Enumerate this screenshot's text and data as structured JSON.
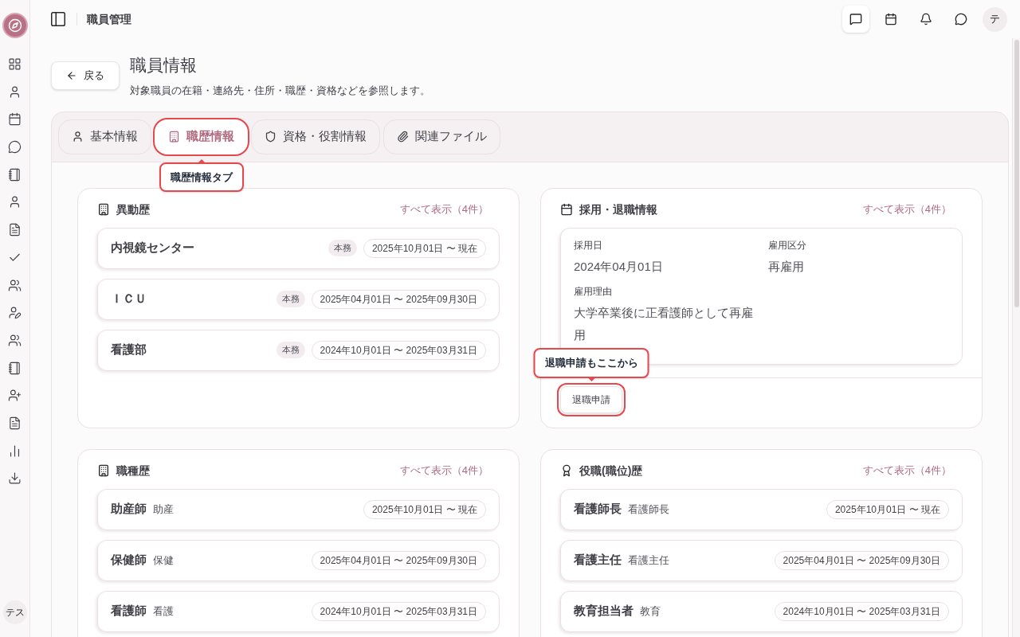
{
  "header": {
    "title": "職員管理",
    "avatar": "テ"
  },
  "sidebar": {
    "avatar": "テス"
  },
  "page": {
    "back": "戻る",
    "title": "職員情報",
    "subtitle": "対象職員の在籍・連絡先・住所・職歴・資格などを参照します。"
  },
  "tabs": [
    {
      "label": "基本情報",
      "selected": false,
      "highlighted": false
    },
    {
      "label": "職歴情報",
      "selected": true,
      "highlighted": true,
      "callout": "職歴情報タブ"
    },
    {
      "label": "資格・役割情報",
      "selected": false,
      "highlighted": false
    },
    {
      "label": "関連ファイル",
      "selected": false,
      "highlighted": false
    }
  ],
  "sections": [
    {
      "kind": "history",
      "title": "異動歴",
      "link": "すべて表示（4件）",
      "items": [
        {
          "name": "内視鏡センター",
          "badge": "本務",
          "period": "2025年10月01日 〜 現在"
        },
        {
          "name": "ＩＣＵ",
          "badge": "本務",
          "period": "2025年04月01日 〜 2025年09月30日"
        },
        {
          "name": "看護部",
          "badge": "本務",
          "period": "2024年10月01日 〜 2025年03月31日"
        }
      ]
    },
    {
      "kind": "employment",
      "title": "採用・退職情報",
      "link": "すべて表示（4件）",
      "fields": [
        {
          "label": "採用日",
          "value": "2024年04月01日"
        },
        {
          "label": "雇用区分",
          "value": "再雇用"
        },
        {
          "label": "雇用理由",
          "value": "大学卒業後に正看護師として再雇用"
        }
      ],
      "button": {
        "label": "退職申請",
        "highlighted": true,
        "callout": "退職申請もここから"
      }
    },
    {
      "kind": "history",
      "title": "職種歴",
      "link": "すべて表示（4件）",
      "items": [
        {
          "name": "助産師",
          "sub": "助産",
          "period": "2025年10月01日 〜 現在"
        },
        {
          "name": "保健師",
          "sub": "保健",
          "period": "2025年04月01日 〜 2025年09月30日"
        },
        {
          "name": "看護師",
          "sub": "看護",
          "period": "2024年10月01日 〜 2025年03月31日"
        }
      ]
    },
    {
      "kind": "history",
      "title": "役職(職位)歴",
      "link": "すべて表示（4件）",
      "items": [
        {
          "name": "看護師長",
          "sub": "看護師長",
          "period": "2025年10月01日 〜 現在"
        },
        {
          "name": "看護主任",
          "sub": "看護主任",
          "period": "2025年04月01日 〜 2025年09月30日"
        },
        {
          "name": "教育担当者",
          "sub": "教育",
          "period": "2024年10月01日 〜 2025年03月31日"
        }
      ]
    }
  ]
}
